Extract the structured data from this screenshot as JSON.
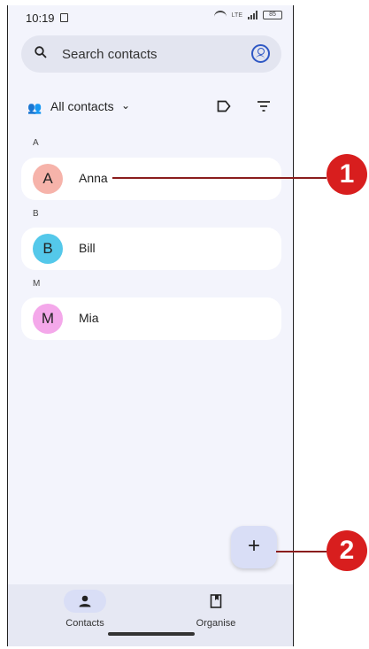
{
  "status_bar": {
    "time": "10:19",
    "network": "LTE",
    "battery": "85"
  },
  "search": {
    "placeholder": "Search contacts"
  },
  "filter": {
    "label": "All contacts"
  },
  "contacts": [
    {
      "section": "A",
      "initial": "A",
      "name": "Anna",
      "avatar_color": "#f6b3aa"
    },
    {
      "section": "B",
      "initial": "B",
      "name": "Bill",
      "avatar_color": "#54c8ea"
    },
    {
      "section": "M",
      "initial": "M",
      "name": "Mia",
      "avatar_color": "#f4a8ea"
    }
  ],
  "fab": {
    "label": "+"
  },
  "bottom_nav": {
    "items": [
      {
        "label": "Contacts",
        "icon": "person-icon",
        "selected": true
      },
      {
        "label": "Organise",
        "icon": "bookmark-icon",
        "selected": false
      }
    ]
  },
  "callouts": [
    {
      "label": "1"
    },
    {
      "label": "2"
    }
  ],
  "colors": {
    "background": "#f3f4fc",
    "accent": "#2f58c4",
    "callout": "#d81e1e"
  }
}
